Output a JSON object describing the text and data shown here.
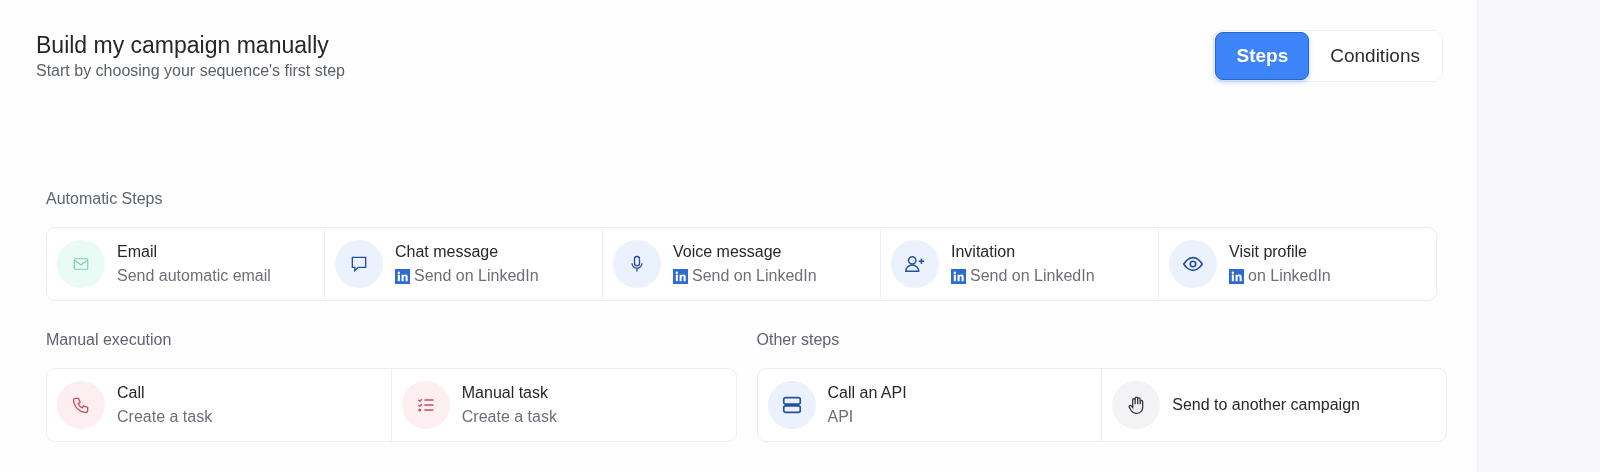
{
  "header": {
    "title": "Build my campaign manually",
    "subtitle": "Start by choosing your sequence's first step"
  },
  "tabs": [
    {
      "label": "Steps",
      "selected": true
    },
    {
      "label": "Conditions",
      "selected": false
    }
  ],
  "automatic": {
    "title": "Automatic Steps",
    "steps": [
      {
        "kind": "email",
        "name": "Email",
        "detail": "Send automatic email",
        "linkedin": false
      },
      {
        "kind": "chat",
        "name": "Chat message",
        "detail": "Send on LinkedIn",
        "linkedin": true
      },
      {
        "kind": "voice",
        "name": "Voice message",
        "detail": "Send on LinkedIn",
        "linkedin": true
      },
      {
        "kind": "invitation",
        "name": "Invitation",
        "detail": "Send on LinkedIn",
        "linkedin": true
      },
      {
        "kind": "visit",
        "name": "Visit profile",
        "detail": "on LinkedIn",
        "linkedin": true
      }
    ]
  },
  "manual": {
    "title": "Manual execution",
    "steps": [
      {
        "kind": "call",
        "name": "Call",
        "detail": "Create a task",
        "linkedin": false
      },
      {
        "kind": "task",
        "name": "Manual task",
        "detail": "Create a task",
        "linkedin": false
      }
    ]
  },
  "other": {
    "title": "Other steps",
    "steps": [
      {
        "kind": "api",
        "name": "Call an API",
        "detail": "API",
        "linkedin": false
      },
      {
        "kind": "campaign",
        "name": "Send to another campaign",
        "linkedin": false
      }
    ]
  }
}
